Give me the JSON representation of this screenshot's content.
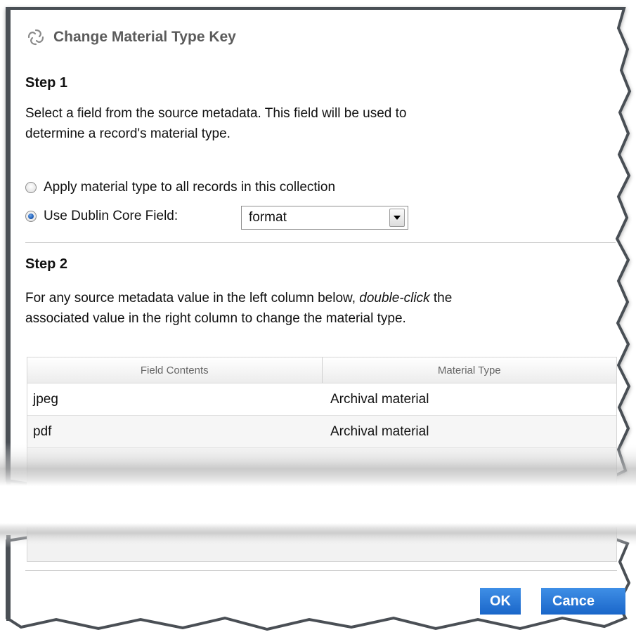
{
  "dialog": {
    "title": "Change Material Type Key",
    "icon": "spiral-logo-icon"
  },
  "step1": {
    "heading": "Step 1",
    "line1": "Select a field from the source metadata. This field will be used to",
    "line2": "determine a record's material type.",
    "option_all_label": "Apply material type to all records in this collection",
    "option_all_selected": false,
    "option_dc_label": "Use Dublin Core Field:",
    "option_dc_selected": true,
    "dc_field_value": "format"
  },
  "step2": {
    "heading": "Step 2",
    "line1_a": "For any source metadata value in the left column below, ",
    "line1_em": "double-click",
    "line1_b": " the",
    "line2": "associated value in the right column to change the material type."
  },
  "table": {
    "columns": [
      "Field Contents",
      "Material Type"
    ],
    "rows": [
      {
        "field": "jpeg",
        "type": "Archival material"
      },
      {
        "field": "pdf",
        "type": "Archival material"
      }
    ]
  },
  "buttons": {
    "ok": "OK",
    "cancel": "Cance"
  },
  "colors": {
    "button_blue": "#1a66c9",
    "frame_gray": "#4a4f55"
  }
}
